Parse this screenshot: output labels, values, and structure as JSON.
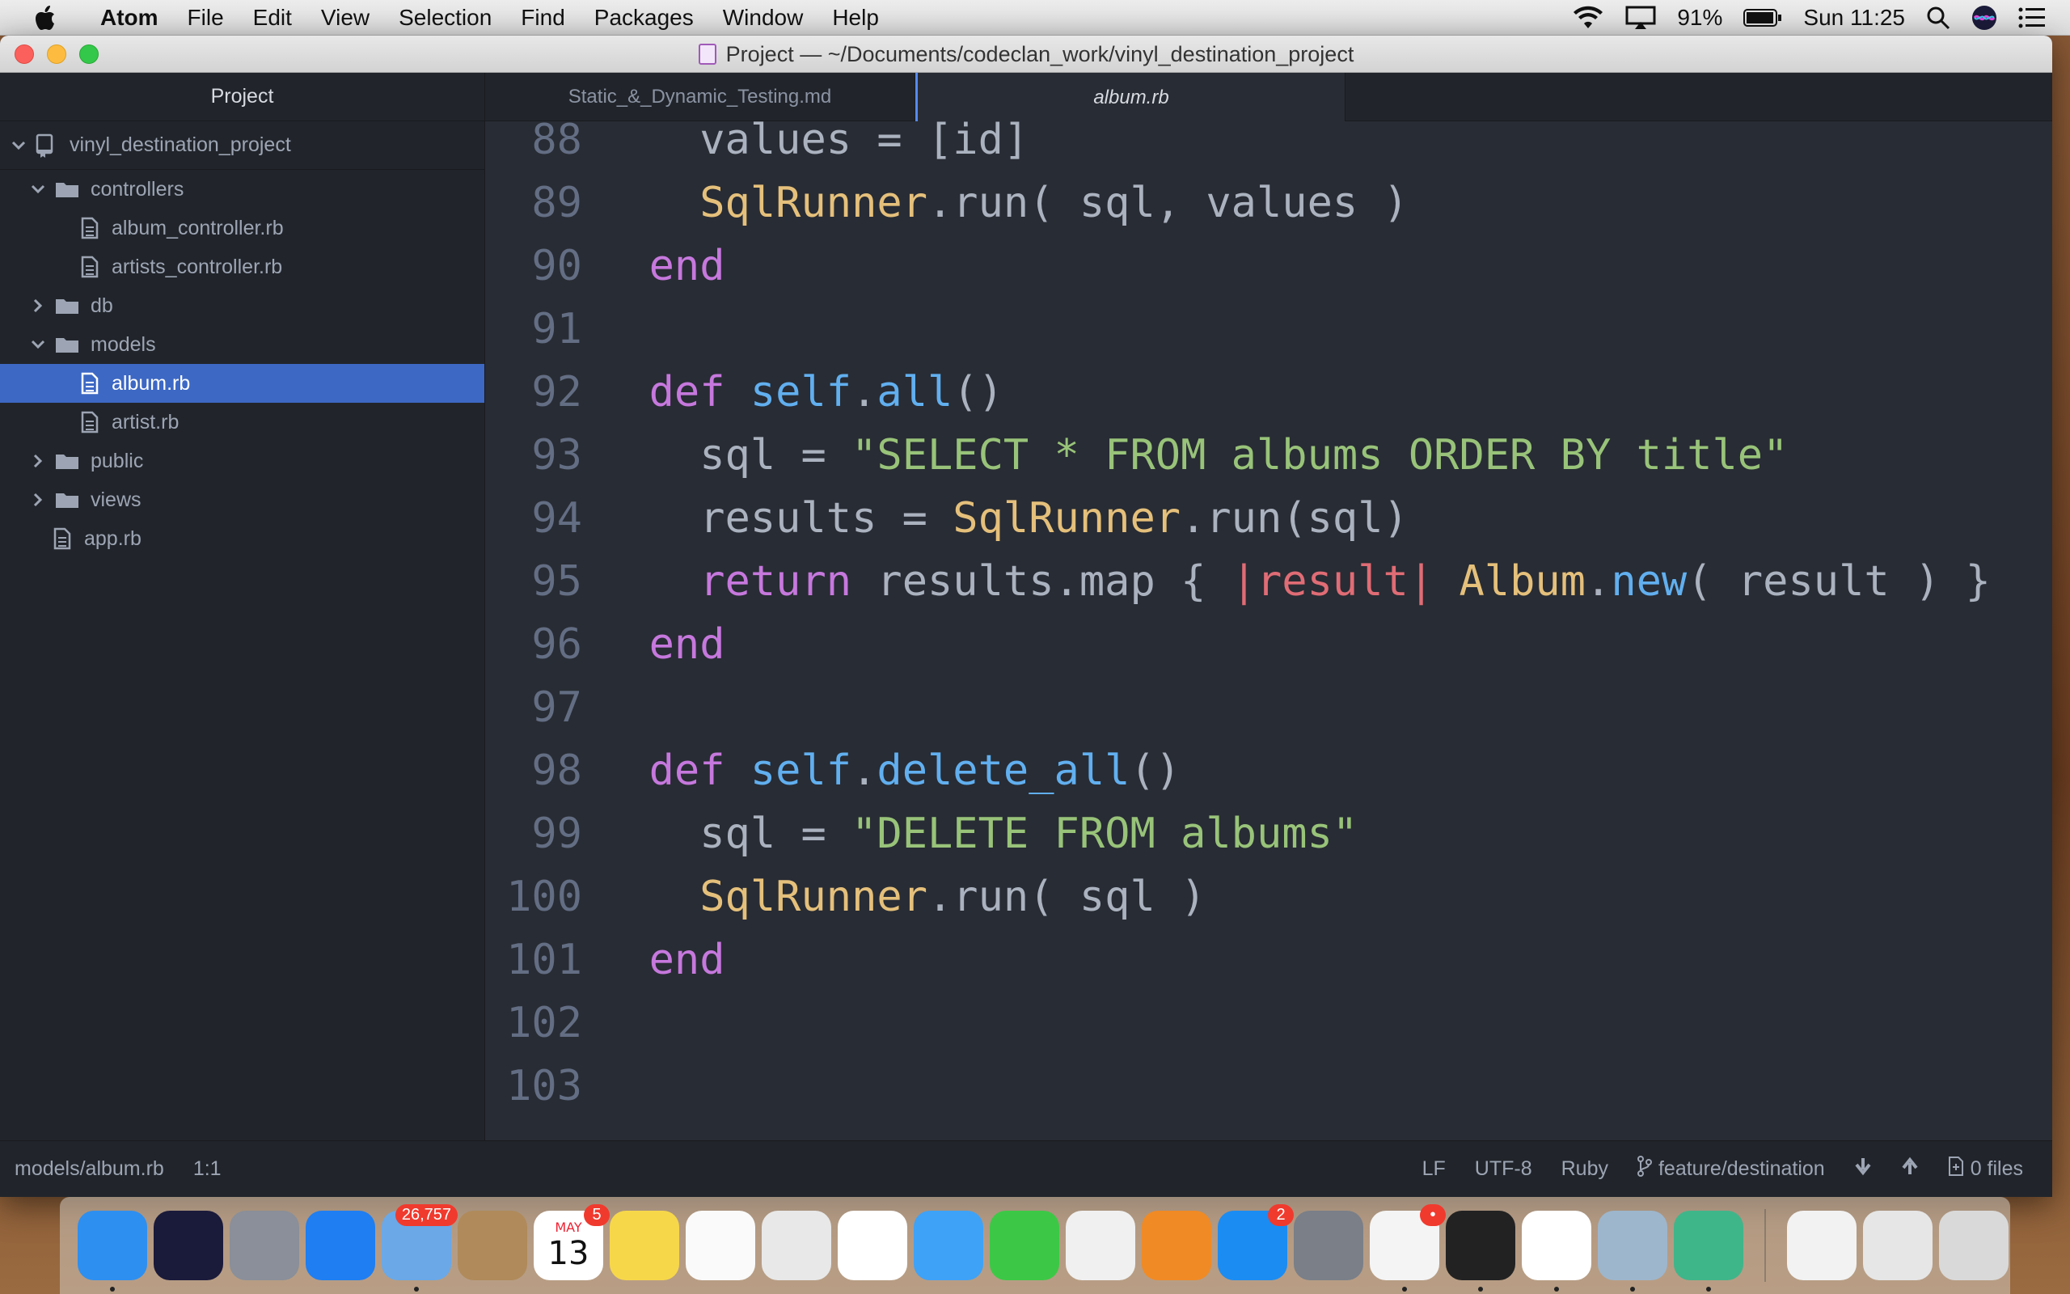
{
  "menubar": {
    "app_name": "Atom",
    "menus": [
      "File",
      "Edit",
      "View",
      "Selection",
      "Find",
      "Packages",
      "Window",
      "Help"
    ],
    "battery": "91%",
    "clock": "Sun 11:25"
  },
  "window": {
    "title": "Project — ~/Documents/codeclan_work/vinyl_destination_project"
  },
  "tree": {
    "header": "Project",
    "root": "vinyl_destination_project",
    "items": [
      {
        "label": "controllers",
        "kind": "folder",
        "expanded": true,
        "depth": 1
      },
      {
        "label": "album_controller.rb",
        "kind": "file",
        "depth": 2
      },
      {
        "label": "artists_controller.rb",
        "kind": "file",
        "depth": 2
      },
      {
        "label": "db",
        "kind": "folder",
        "expanded": false,
        "depth": 1
      },
      {
        "label": "models",
        "kind": "folder",
        "expanded": true,
        "depth": 1
      },
      {
        "label": "album.rb",
        "kind": "file",
        "depth": 2,
        "selected": true
      },
      {
        "label": "artist.rb",
        "kind": "file",
        "depth": 2
      },
      {
        "label": "public",
        "kind": "folder",
        "expanded": false,
        "depth": 1
      },
      {
        "label": "views",
        "kind": "folder",
        "expanded": false,
        "depth": 1
      },
      {
        "label": "app.rb",
        "kind": "file",
        "depth": 1
      }
    ]
  },
  "tabs": [
    {
      "label": "Static_&_Dynamic_Testing.md",
      "active": false
    },
    {
      "label": "album.rb",
      "active": true
    }
  ],
  "editor": {
    "lines": [
      {
        "n": "88",
        "tokens": [
          [
            "p",
            "    values = [id]"
          ]
        ]
      },
      {
        "n": "89",
        "tokens": [
          [
            "p",
            "    "
          ],
          [
            "c",
            "SqlRunner"
          ],
          [
            "p",
            ".run( sql, values )"
          ]
        ]
      },
      {
        "n": "90",
        "tokens": [
          [
            "k",
            "  end"
          ]
        ]
      },
      {
        "n": "91",
        "tokens": []
      },
      {
        "n": "92",
        "tokens": [
          [
            "k",
            "  def "
          ],
          [
            "f",
            "self"
          ],
          [
            "p",
            "."
          ],
          [
            "f",
            "all"
          ],
          [
            "p",
            "()"
          ]
        ]
      },
      {
        "n": "93",
        "tokens": [
          [
            "p",
            "    sql = "
          ],
          [
            "s",
            "\"SELECT * FROM albums ORDER BY title\""
          ]
        ]
      },
      {
        "n": "94",
        "tokens": [
          [
            "p",
            "    results = "
          ],
          [
            "c",
            "SqlRunner"
          ],
          [
            "p",
            ".run(sql)"
          ]
        ]
      },
      {
        "n": "95",
        "tokens": [
          [
            "k",
            "    return"
          ],
          [
            "p",
            " results.map { "
          ],
          [
            "v",
            "|result|"
          ],
          [
            "p",
            " "
          ],
          [
            "c",
            "Album"
          ],
          [
            "p",
            "."
          ],
          [
            "f",
            "new"
          ],
          [
            "p",
            "( result ) }"
          ]
        ]
      },
      {
        "n": "96",
        "tokens": [
          [
            "k",
            "  end"
          ]
        ]
      },
      {
        "n": "97",
        "tokens": []
      },
      {
        "n": "98",
        "tokens": [
          [
            "k",
            "  def "
          ],
          [
            "f",
            "self"
          ],
          [
            "p",
            "."
          ],
          [
            "f",
            "delete_all"
          ],
          [
            "p",
            "()"
          ]
        ]
      },
      {
        "n": "99",
        "tokens": [
          [
            "p",
            "    sql = "
          ],
          [
            "s",
            "\"DELETE FROM albums\""
          ]
        ]
      },
      {
        "n": "100",
        "tokens": [
          [
            "p",
            "    "
          ],
          [
            "c",
            "SqlRunner"
          ],
          [
            "p",
            ".run( sql )"
          ]
        ]
      },
      {
        "n": "101",
        "tokens": [
          [
            "k",
            "  end"
          ]
        ]
      },
      {
        "n": "102",
        "tokens": []
      },
      {
        "n": "103",
        "tokens": []
      }
    ]
  },
  "statusbar": {
    "path": "models/album.rb",
    "cursor": "1:1",
    "line_ending": "LF",
    "encoding": "UTF-8",
    "grammar": "Ruby",
    "branch": "feature/destination",
    "files": "0 files"
  },
  "dock": {
    "apps": [
      {
        "icon": "finder-icon",
        "color": "#2d8ff0",
        "running": true
      },
      {
        "icon": "siri-icon",
        "color": "#1a1a3a"
      },
      {
        "icon": "launchpad-icon",
        "color": "#8a8f99"
      },
      {
        "icon": "safari-icon",
        "color": "#1e7ef2"
      },
      {
        "icon": "mail-icon",
        "color": "#6aa8e8",
        "badge": "26,757",
        "running": true
      },
      {
        "icon": "contacts-icon",
        "color": "#b08a5a"
      },
      {
        "icon": "calendar-icon",
        "color": "#ffffff",
        "badge": "5",
        "text_top": "MAY",
        "text_main": "13"
      },
      {
        "icon": "notes-icon",
        "color": "#f7d74a"
      },
      {
        "icon": "reminders-icon",
        "color": "#fafafa"
      },
      {
        "icon": "preview-icon",
        "color": "#e8e8e8"
      },
      {
        "icon": "photos-icon",
        "color": "#ffffff"
      },
      {
        "icon": "messages-icon",
        "color": "#3ea2f7"
      },
      {
        "icon": "facetime-icon",
        "color": "#3cc846"
      },
      {
        "icon": "itunes-icon",
        "color": "#f0f0f0"
      },
      {
        "icon": "ibooks-icon",
        "color": "#f08a24"
      },
      {
        "icon": "app-store-icon",
        "color": "#1b8cf2",
        "badge": "2"
      },
      {
        "icon": "system-preferences-icon",
        "color": "#7a7f88"
      },
      {
        "icon": "slack-icon",
        "color": "#f4f4f4",
        "badge": "•",
        "running": true
      },
      {
        "icon": "terminal-icon",
        "color": "#222222",
        "running": true
      },
      {
        "icon": "chrome-icon",
        "color": "#ffffff",
        "running": true
      },
      {
        "icon": "image-capture-icon",
        "color": "#9db6cc",
        "running": true
      },
      {
        "icon": "atom-icon",
        "color": "#3fb58a",
        "running": true
      }
    ],
    "stacks": [
      {
        "icon": "zip-file-icon",
        "color": "#f2f2f2"
      },
      {
        "icon": "window-stack-icon",
        "color": "#e6e6e6"
      },
      {
        "icon": "trash-icon",
        "color": "#d9d9d9"
      }
    ]
  }
}
